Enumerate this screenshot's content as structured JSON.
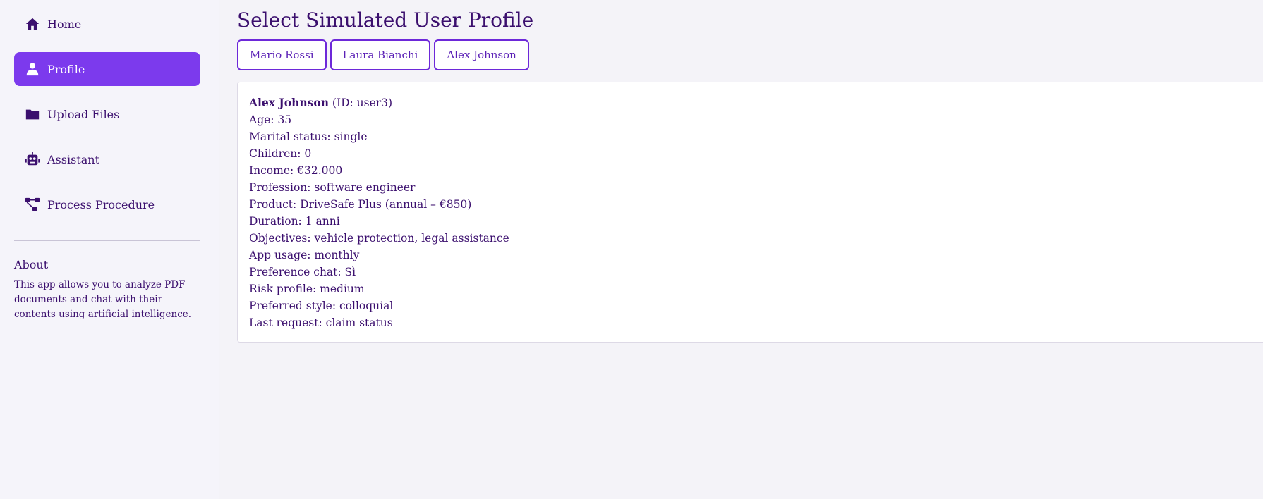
{
  "sidebar": {
    "items": [
      {
        "label": "Home",
        "icon": "home-icon"
      },
      {
        "label": "Profile",
        "icon": "user-icon",
        "active": true
      },
      {
        "label": "Upload Files",
        "icon": "folder-icon"
      },
      {
        "label": "Assistant",
        "icon": "robot-icon"
      },
      {
        "label": "Process Procedure",
        "icon": "workflow-icon"
      }
    ],
    "about": {
      "title": "About",
      "text": "This app allows you to analyze PDF documents and chat with their contents using artificial intelligence."
    }
  },
  "main": {
    "title": "Select Simulated User Profile",
    "profiles": [
      "Mario Rossi",
      "Laura Bianchi",
      "Alex Johnson"
    ],
    "selected_profile": {
      "name": "Alex Johnson",
      "id_text": "(ID: user3)",
      "lines": [
        "Age: 35",
        "Marital status: single",
        "Children: 0",
        "Income: €32.000",
        "Profession: software engineer",
        "Product: DriveSafe Plus (annual – €850)",
        "Duration: 1 anni",
        "Objectives: vehicle protection, legal assistance",
        "App usage: monthly",
        "Preference chat: Sì",
        "Risk profile: medium",
        "Preferred style: colloquial",
        "Last request: claim status"
      ]
    }
  },
  "colors": {
    "accent": "#7c3aed",
    "text": "#3b0f6e",
    "background": "#f4f3f8"
  }
}
